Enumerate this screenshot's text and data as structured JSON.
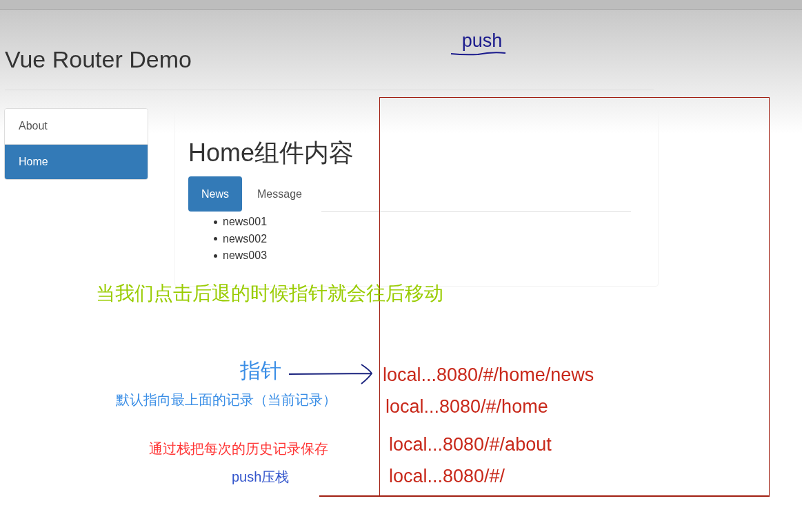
{
  "header": {
    "title": "Vue Router Demo"
  },
  "sidebar": {
    "items": [
      {
        "label": "About",
        "selected": false
      },
      {
        "label": "Home",
        "selected": true
      }
    ]
  },
  "panel": {
    "title": "Home组件内容",
    "tabs": [
      {
        "label": "News",
        "selected": true
      },
      {
        "label": "Message",
        "selected": false
      }
    ],
    "news": [
      "news001",
      "news002",
      "news003"
    ]
  },
  "annotations": {
    "push_label": "push",
    "back_note": "当我们点击后退的时候指针就会往后移动",
    "pointer_label": "指针",
    "pointer_note": "默认指向最上面的记录（当前记录）",
    "stack_note": "通过栈把每次的历史记录保存",
    "push_note": "push压栈",
    "stack": [
      "local...8080/#/home/news",
      "local...8080/#/home",
      "local...8080/#/about",
      "local...8080/#/"
    ]
  }
}
